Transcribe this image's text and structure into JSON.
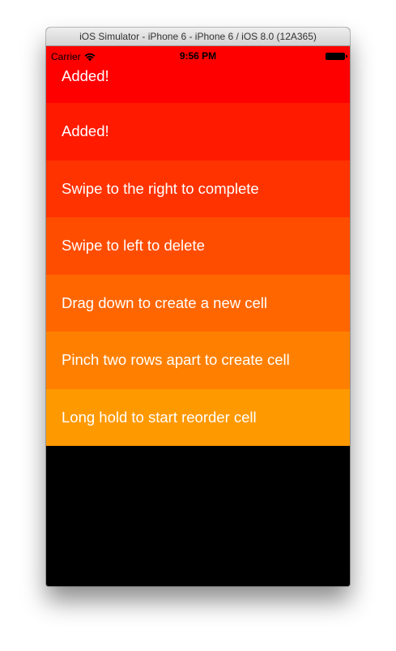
{
  "window": {
    "title": "iOS Simulator - iPhone 6 - iPhone 6 / iOS 8.0 (12A365)"
  },
  "status_bar": {
    "carrier": "Carrier",
    "time": "9:56 PM",
    "wifi_icon": "wifi-icon",
    "battery_icon": "battery-icon"
  },
  "list": {
    "rows": [
      {
        "label": "Added!",
        "color": "#ff0000"
      },
      {
        "label": "Added!",
        "color": "#ff1a00"
      },
      {
        "label": "Swipe to the right to complete",
        "color": "#ff3300"
      },
      {
        "label": "Swipe to left to delete",
        "color": "#ff4d00"
      },
      {
        "label": "Drag down to create a new cell",
        "color": "#ff6600"
      },
      {
        "label": "Pinch two rows apart to create cell",
        "color": "#ff8000"
      },
      {
        "label": "Long hold to start reorder cell",
        "color": "#ff9900"
      }
    ]
  },
  "colors": {
    "screen_background": "#000000",
    "text": "#ffffff"
  }
}
